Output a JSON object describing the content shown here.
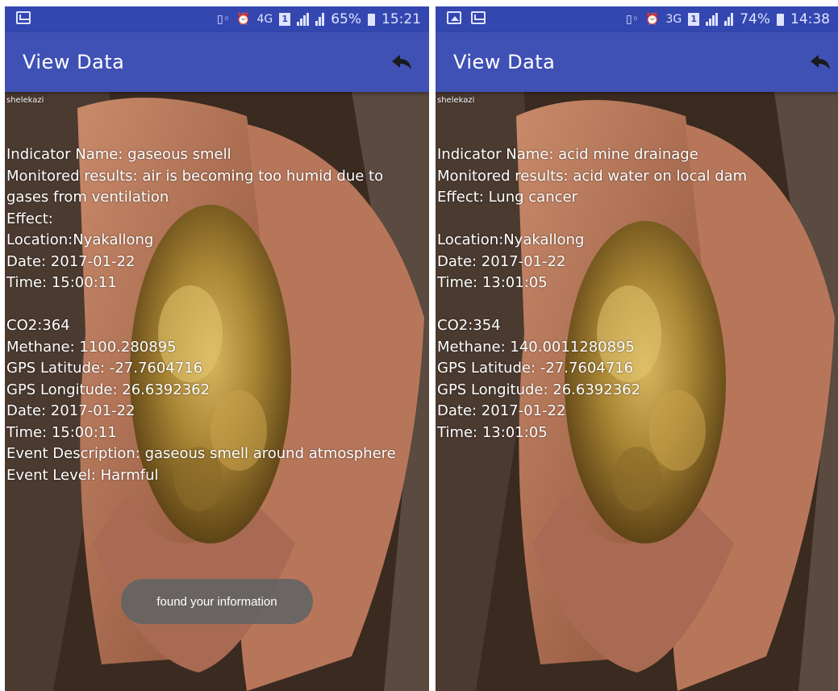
{
  "screens": [
    {
      "status_bar": {
        "battery": "65%",
        "time": "15:21",
        "network": "4G",
        "sim": "1"
      },
      "app_bar": {
        "title": "View Data"
      },
      "username": "shelekazi",
      "lines_a": [
        "Indicator Name: gaseous smell",
        "Monitored results: air is becoming too humid due to gases from ventilation",
        "Effect:",
        "Location:Nyakallong",
        "Date: 2017-01-22",
        "Time: 15:00:11"
      ],
      "lines_b": [
        "CO2:364",
        "Methane: 1100.280895",
        "GPS Latitude: -27.7604716",
        "GPS Longitude: 26.6392362",
        "Date: 2017-01-22",
        "Time: 15:00:11",
        "Event Description: gaseous smell around atmosphere",
        "Event Level: Harmful"
      ],
      "toast": "found your information"
    },
    {
      "status_bar": {
        "battery": "74%",
        "time": "14:38",
        "network": "3G",
        "sim": "1"
      },
      "app_bar": {
        "title": "View Data"
      },
      "username": "shelekazi",
      "lines_a": [
        "Indicator Name: acid mine drainage",
        "Monitored results: acid water on local dam",
        "Effect: Lung cancer",
        "",
        "Location:Nyakallong",
        "Date: 2017-01-22",
        "Time: 13:01:05"
      ],
      "lines_b": [
        "CO2:354",
        "Methane: 140.0011280895",
        "GPS Latitude: -27.7604716",
        "GPS Longitude: 26.6392362",
        "Date: 2017-01-22",
        "Time: 13:01:05"
      ]
    }
  ],
  "icons": {
    "back": "back-arrow-icon",
    "message": "message-icon",
    "gallery": "gallery-icon",
    "alarm": "alarm-icon",
    "vibrate": "vibrate-icon",
    "signal": "signal-icon",
    "battery": "battery-icon"
  },
  "colors": {
    "status_bar": "#3447b0",
    "app_bar": "#3f51b5",
    "toast": "#646464"
  }
}
